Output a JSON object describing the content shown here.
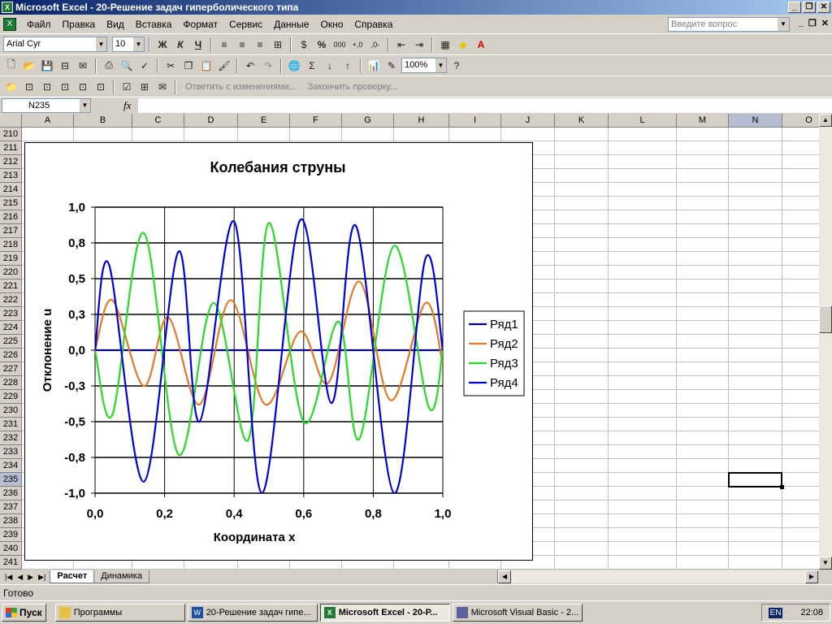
{
  "window": {
    "title": "Microsoft Excel - 20-Решение задач гиперболического типа"
  },
  "menu": {
    "items": [
      "Файл",
      "Правка",
      "Вид",
      "Вставка",
      "Формат",
      "Сервис",
      "Данные",
      "Окно",
      "Справка"
    ],
    "help_placeholder": "Введите вопрос"
  },
  "format_toolbar": {
    "font": "Arial Cyr",
    "size": "10",
    "bold": "Ж",
    "italic": "К",
    "underline": "Ч",
    "percent": "%",
    "thousands": "000"
  },
  "standard_toolbar": {
    "zoom": "100%"
  },
  "review_toolbar": {
    "reply": "Ответить с изменениями...",
    "end_review": "Закончить проверку..."
  },
  "formula_bar": {
    "name_box": "N235",
    "fx": "fx",
    "value": ""
  },
  "columns": [
    "A",
    "B",
    "C",
    "D",
    "E",
    "F",
    "G",
    "H",
    "I",
    "J",
    "K",
    "L",
    "M",
    "N",
    "O"
  ],
  "rows": [
    "210",
    "211",
    "212",
    "213",
    "214",
    "215",
    "216",
    "217",
    "218",
    "219",
    "220",
    "221",
    "222",
    "223",
    "224",
    "225",
    "226",
    "227",
    "228",
    "229",
    "230",
    "231",
    "232",
    "233",
    "234",
    "235",
    "236",
    "237",
    "238",
    "239",
    "240",
    "241"
  ],
  "selected": {
    "column": "N",
    "row": "235"
  },
  "chart_data": {
    "type": "line",
    "title": "Колебания струны",
    "xlabel": "Координата x",
    "ylabel": "Отклонение u",
    "xlim": [
      0,
      1
    ],
    "ylim": [
      -1,
      1
    ],
    "x_ticks": [
      "0,0",
      "0,2",
      "0,4",
      "0,6",
      "0,8",
      "1,0"
    ],
    "y_ticks": [
      "1,0",
      "0,8",
      "0,5",
      "0,3",
      "0,0",
      "-0,3",
      "-0,5",
      "-0,8",
      "-1,0"
    ],
    "legend_position": "right",
    "series": [
      {
        "name": "Ряд1",
        "color": "#00008b",
        "x": [
          0,
          1
        ],
        "y": [
          0,
          0
        ]
      },
      {
        "name": "Ряд2",
        "color": "#e87722",
        "x": [
          0,
          0.05,
          0.14,
          0.21,
          0.3,
          0.39,
          0.49,
          0.59,
          0.67,
          0.76,
          0.85,
          0.95,
          1
        ],
        "y": [
          0,
          0.35,
          -0.25,
          0.23,
          -0.38,
          0.35,
          -0.38,
          0.13,
          -0.23,
          0.48,
          -0.35,
          0.33,
          -0.1
        ]
      },
      {
        "name": "Ряд3",
        "color": "#22dd22",
        "x": [
          0,
          0.05,
          0.14,
          0.24,
          0.34,
          0.44,
          0.5,
          0.6,
          0.7,
          0.76,
          0.86,
          0.96,
          1
        ],
        "y": [
          0,
          -0.45,
          0.82,
          -0.73,
          0.33,
          -0.63,
          0.89,
          -0.5,
          0.2,
          -0.62,
          0.73,
          -0.4,
          0
        ]
      },
      {
        "name": "Ряд4",
        "color": "#0000dd",
        "x": [
          0,
          0.04,
          0.14,
          0.24,
          0.3,
          0.4,
          0.48,
          0.59,
          0.68,
          0.75,
          0.86,
          0.95,
          1
        ],
        "y": [
          0,
          0.6,
          -0.92,
          0.69,
          -0.5,
          0.9,
          -1,
          0.91,
          -0.37,
          0.87,
          -1,
          0.64,
          0
        ]
      }
    ]
  },
  "sheets": [
    "Расчет",
    "Динамика"
  ],
  "active_sheet": "Расчет",
  "status": "Готово",
  "taskbar": {
    "start": "Пуск",
    "tasks": [
      "Программы",
      "20-Решение задач гипе...",
      "Microsoft Excel - 20-Р...",
      "Microsoft Visual Basic - 2..."
    ],
    "lang": "EN",
    "clock": "22:08"
  }
}
